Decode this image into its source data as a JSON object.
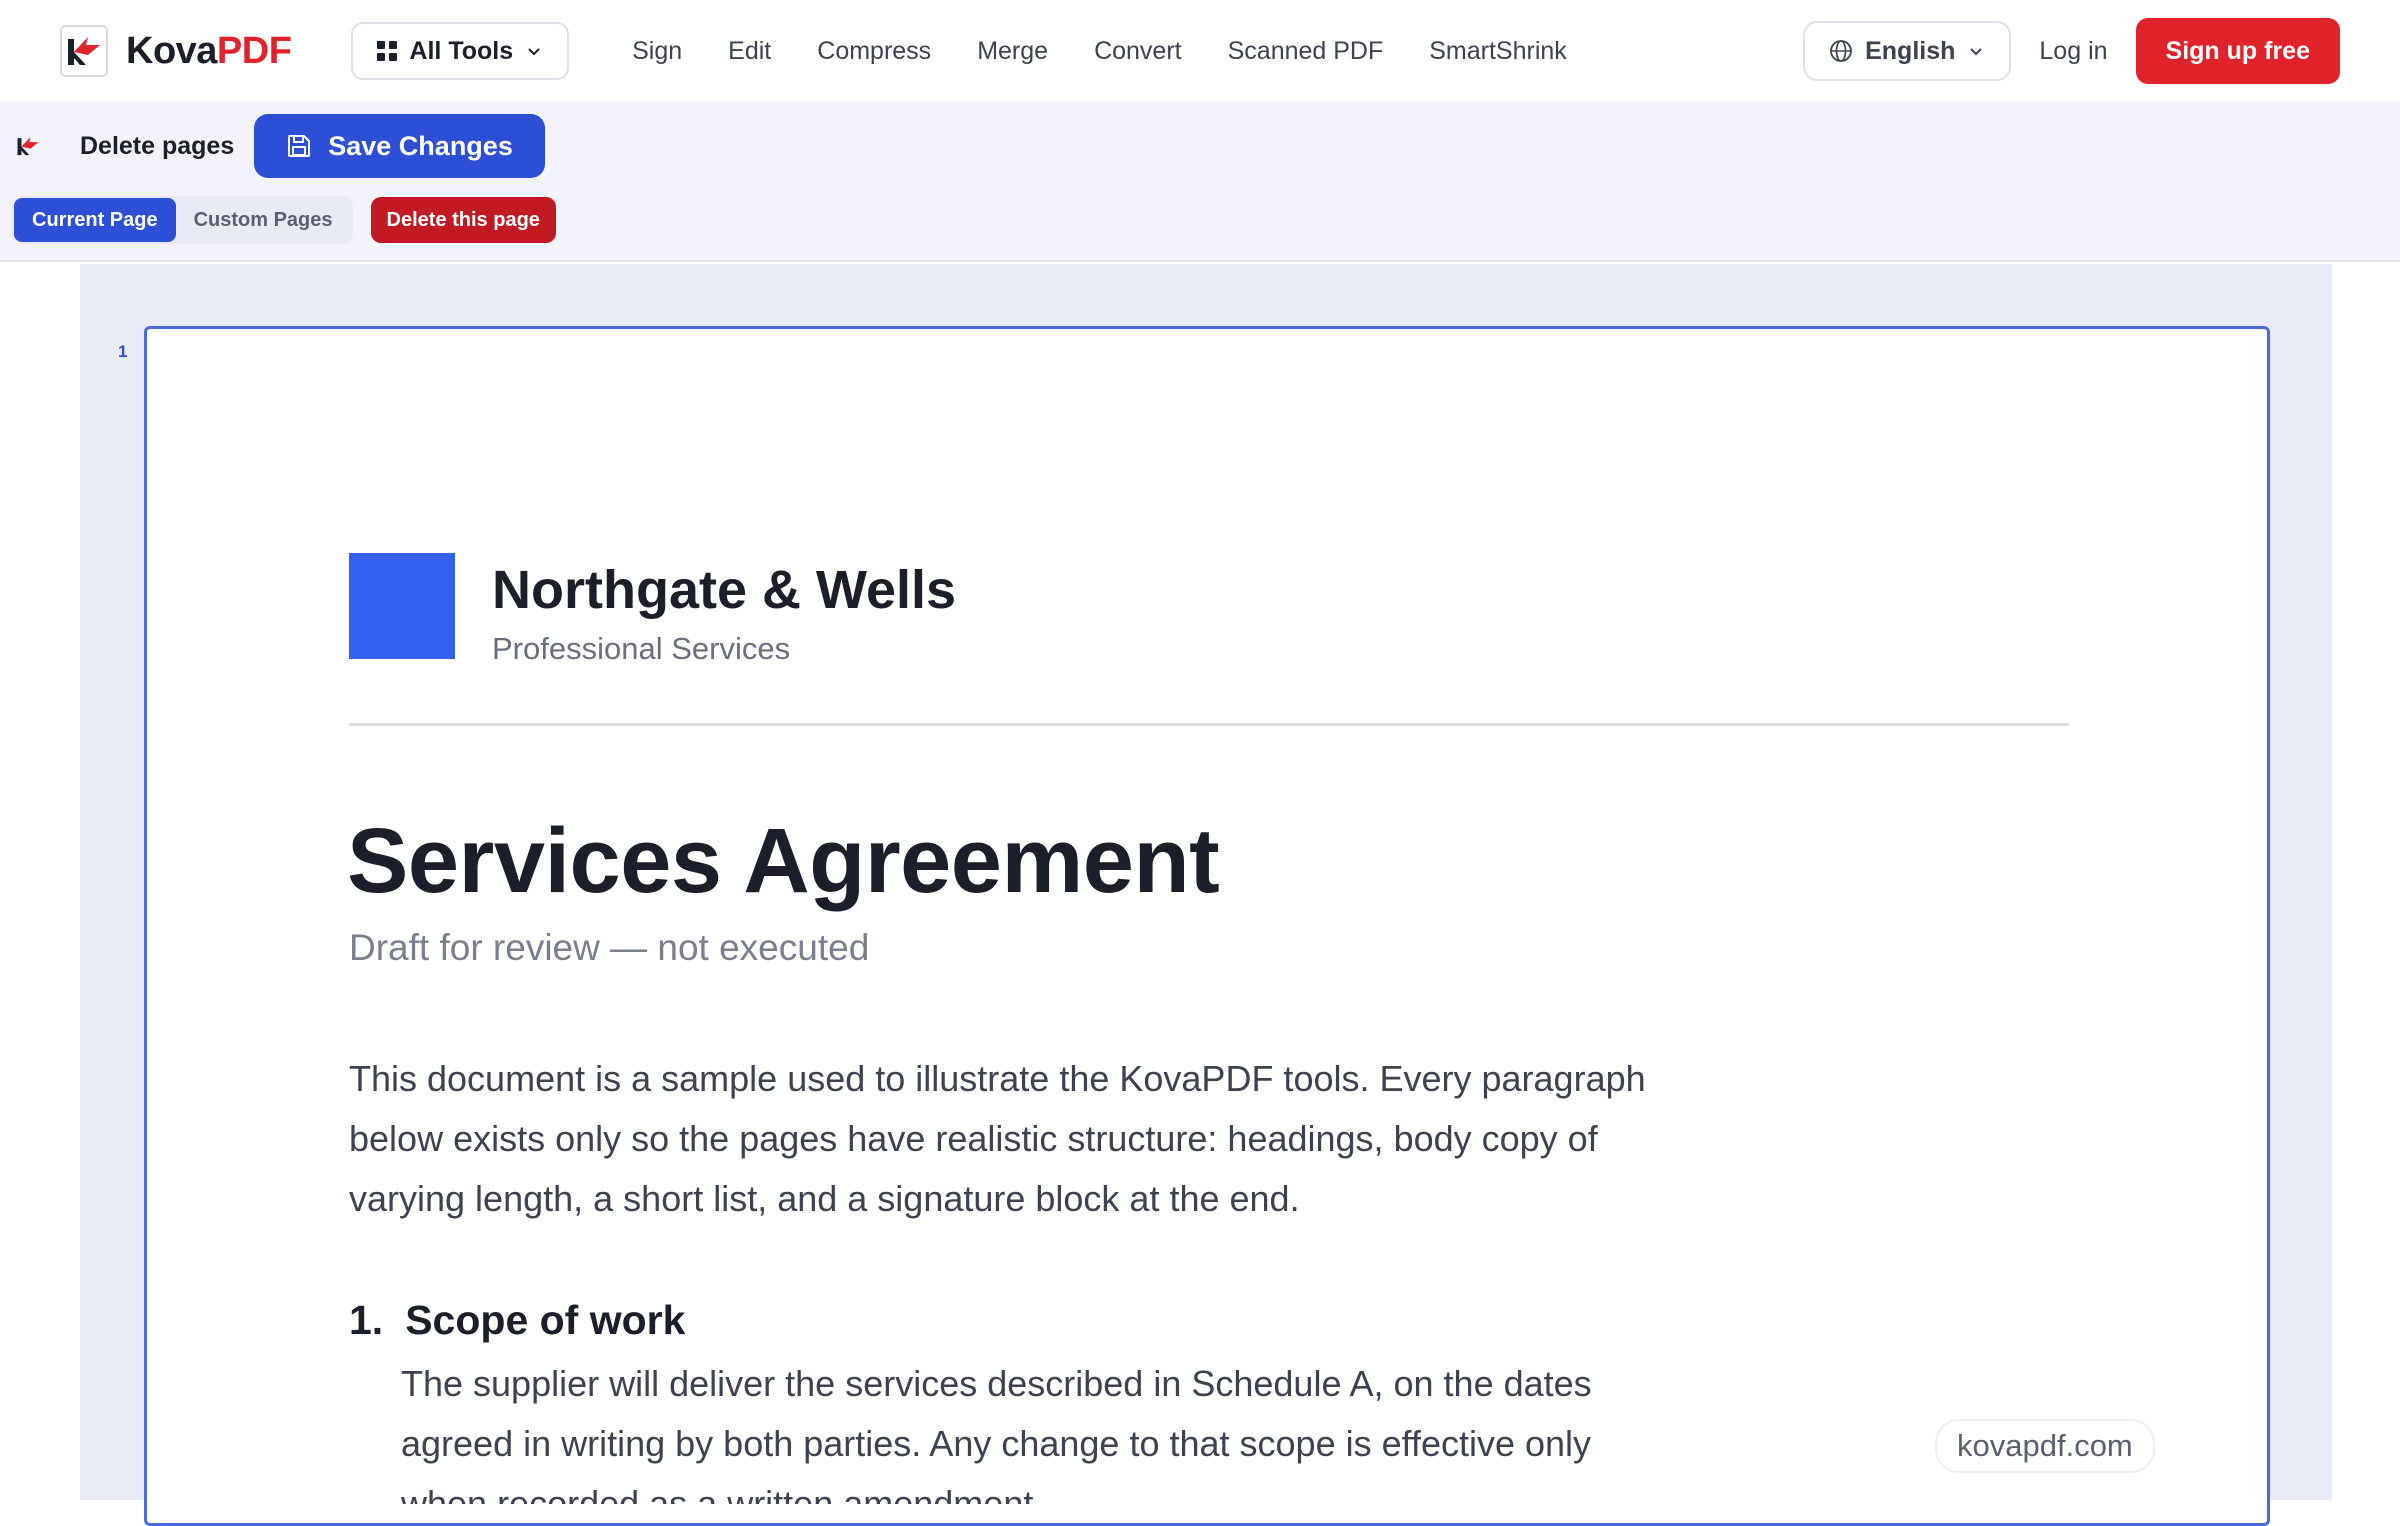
{
  "brand": {
    "name_part1": "Kova",
    "name_part2": "PDF"
  },
  "nav": {
    "all_tools_label": "All Tools",
    "links": [
      "Sign",
      "Edit",
      "Compress",
      "Merge",
      "Convert",
      "Scanned PDF",
      "SmartShrink"
    ],
    "language": "English",
    "login": "Log in",
    "signup": "Sign up free"
  },
  "toolbar": {
    "title": "Delete pages",
    "save_label": "Save Changes",
    "mode_tabs": [
      "Current Page",
      "Custom Pages"
    ],
    "active_mode": "Current Page",
    "delete_label": "Delete this page"
  },
  "viewer": {
    "page_number": "1",
    "document": {
      "company": "Northgate & Wells",
      "division": "Professional Services",
      "title": "Services Agreement",
      "subtitle": "Draft for review — not executed",
      "intro": "This document is a sample used to illustrate the KovaPDF tools. Every paragraph below exists only so the pages have realistic structure: headings, body copy of varying length, a short list, and a signature block at the end.",
      "section_number": "1.",
      "section_title": "Scope of work",
      "section_body": "The supplier will deliver the services described in Schedule A, on the dates agreed in writing by both parties. Any change to that scope is effective only when recorded as a written amendment."
    },
    "watermark": "kovapdf.com"
  },
  "colors": {
    "brand_red": "#e0232b",
    "primary_blue": "#2c4fd6",
    "danger_red": "#c21a22",
    "doc_logo_blue": "#3460f0"
  }
}
